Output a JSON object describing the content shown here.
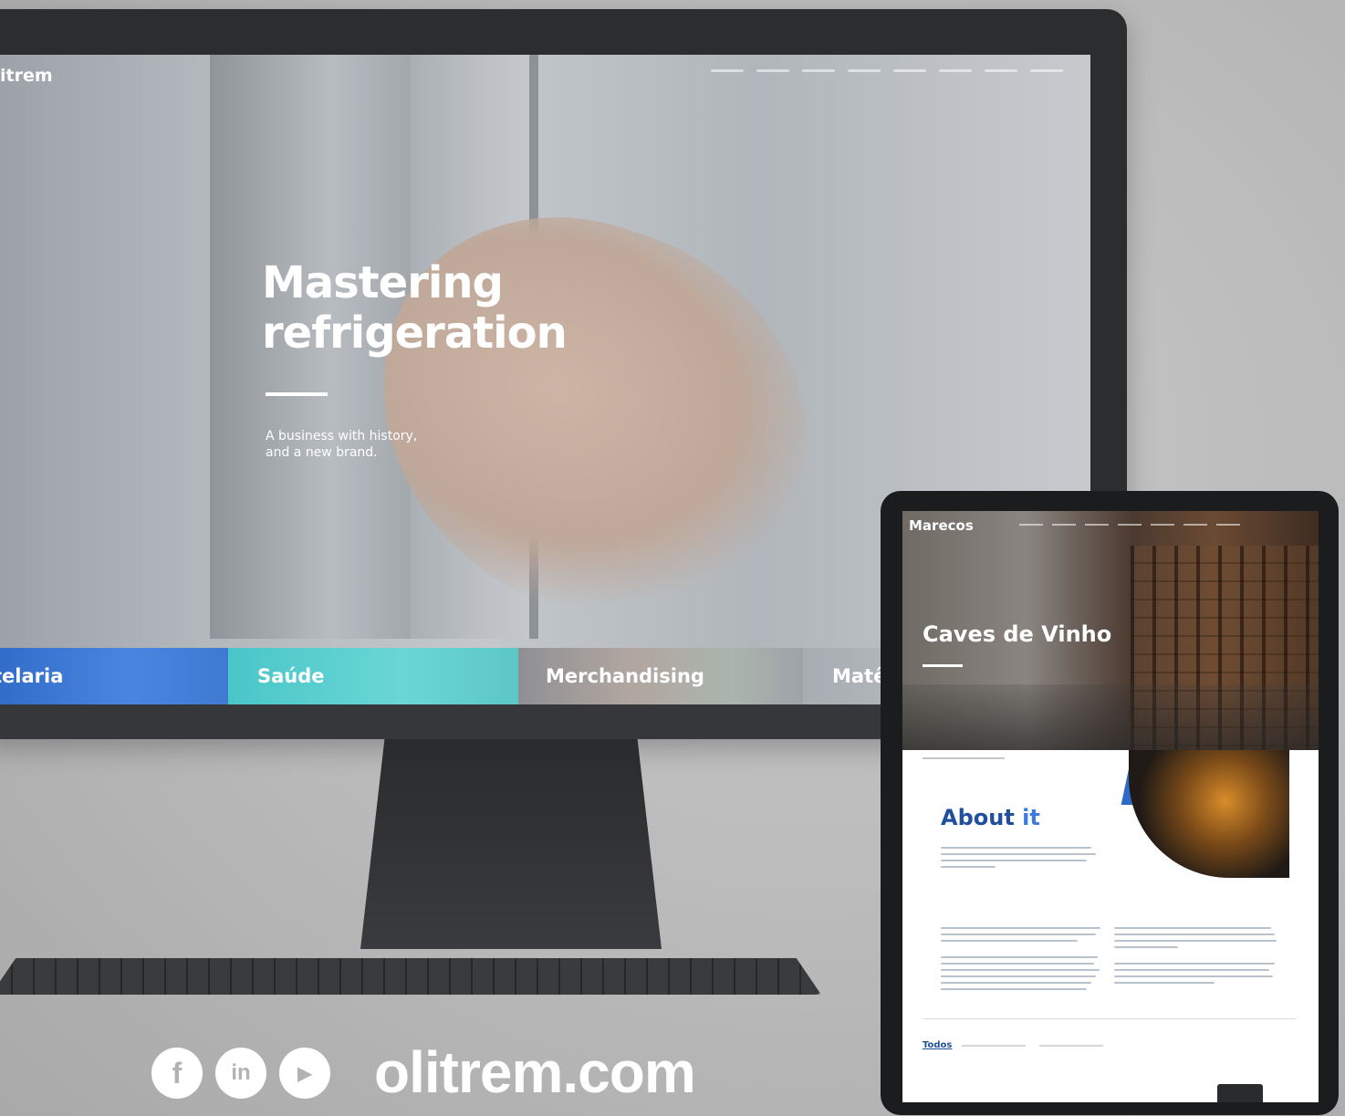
{
  "desktop": {
    "logo": "itrem",
    "hero": {
      "title_line1": "Mastering",
      "title_line2": "refrigeration",
      "subtitle_line1": "A business with history,",
      "subtitle_line2": "and a new brand."
    },
    "categories": [
      "telaria",
      "Saúde",
      "Merchandising",
      "Matê"
    ]
  },
  "tablet": {
    "logo": "Marecos",
    "hero_title": "Caves de Vinho",
    "about_title_main": "About",
    "about_title_accent": "it",
    "filter_all": "Todos"
  },
  "footer": {
    "social_icons": [
      "facebook-icon",
      "linkedin-icon",
      "youtube-icon"
    ],
    "social_glyphs": [
      "f",
      "in",
      "▶"
    ],
    "url": "olitrem.com"
  },
  "colors": {
    "brand_blue": "#1f4f9d",
    "accent_blue": "#3b7be0",
    "hotelaria_tile": "#3f79d2",
    "saude_tile": "#5dc7c8"
  }
}
